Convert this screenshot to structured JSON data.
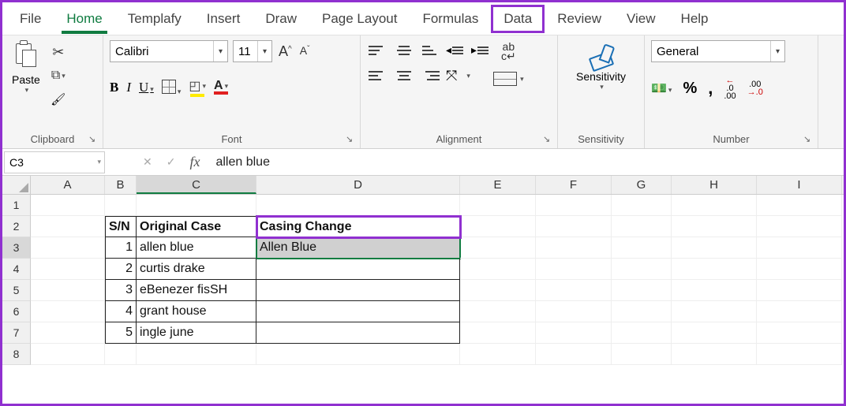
{
  "tabs": {
    "file": "File",
    "home": "Home",
    "templafy": "Templafy",
    "insert": "Insert",
    "draw": "Draw",
    "pagelayout": "Page Layout",
    "formulas": "Formulas",
    "data": "Data",
    "review": "Review",
    "view": "View",
    "help": "Help"
  },
  "ribbon": {
    "clipboard": {
      "label": "Clipboard",
      "paste": "Paste"
    },
    "font": {
      "label": "Font",
      "name": "Calibri",
      "size": "11",
      "bold": "B",
      "italic": "I",
      "underline": "U"
    },
    "alignment": {
      "label": "Alignment",
      "wrap": "ab\nc"
    },
    "sensitivity": {
      "label": "Sensitivity",
      "btn": "Sensitivity"
    },
    "number": {
      "label": "Number",
      "format": "General",
      "pct": "%",
      "comma": ",",
      "incdec1": ".0",
      "incdec1b": ".00",
      "incdec2": ".00",
      "incdec2b": "0"
    }
  },
  "formula_bar": {
    "name_box": "C3",
    "cancel": "✕",
    "enter": "✓",
    "fx": "fx",
    "value": "allen blue"
  },
  "columns": [
    "A",
    "B",
    "C",
    "D",
    "E",
    "F",
    "G",
    "H",
    "I"
  ],
  "rows": [
    "1",
    "2",
    "3",
    "4",
    "5",
    "6",
    "7",
    "8"
  ],
  "table": {
    "headers": {
      "sn": "S/N",
      "orig": "Original Case",
      "change": "Casing Change"
    },
    "data": [
      {
        "sn": "1",
        "orig": "allen blue",
        "change": "Allen Blue"
      },
      {
        "sn": "2",
        "orig": "curtis drake",
        "change": ""
      },
      {
        "sn": "3",
        "orig": "eBenezer fisSH",
        "change": ""
      },
      {
        "sn": "4",
        "orig": "grant house",
        "change": ""
      },
      {
        "sn": "5",
        "orig": "ingle june",
        "change": ""
      }
    ]
  },
  "glyphs": {
    "down": "▾",
    "right": "▸",
    "left": "◂",
    "incA": "A",
    "decA": "A",
    "launch": "↘"
  }
}
